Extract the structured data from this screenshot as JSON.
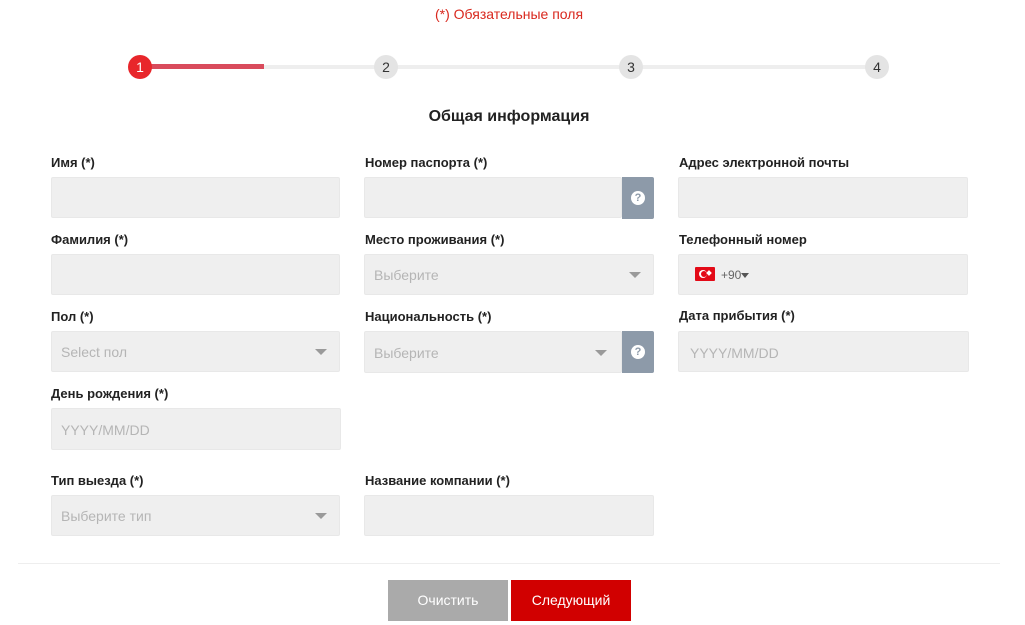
{
  "required_note": "(*) Обязательные поля",
  "stepper": {
    "steps": [
      "1",
      "2",
      "3",
      "4"
    ],
    "active_step": 1,
    "progress": 0.17
  },
  "section_title": "Общая информация",
  "fields": {
    "first_name": {
      "label": "Имя (*)"
    },
    "passport": {
      "label": "Номер паспорта (*)"
    },
    "email": {
      "label": "Адрес электронной почты"
    },
    "last_name": {
      "label": "Фамилия (*)"
    },
    "residence": {
      "label": "Место проживания (*)",
      "placeholder": "Выберите"
    },
    "phone": {
      "label": "Телефонный номер",
      "dial_code": "+90",
      "flag": "turkey-flag"
    },
    "gender": {
      "label": "Пол (*)",
      "placeholder": "Select пол"
    },
    "nationality": {
      "label": "Национальность (*)",
      "placeholder": "Выберите"
    },
    "arrival_date": {
      "label": "Дата прибытия (*)",
      "placeholder": "YYYY/MM/DD"
    },
    "birthday": {
      "label": "День рождения (*)",
      "placeholder": "YYYY/MM/DD"
    },
    "exit_type": {
      "label": "Тип выезда (*)",
      "placeholder": "Выберите тип"
    },
    "company": {
      "label": "Название компании (*)"
    }
  },
  "help_icon": "?",
  "buttons": {
    "clear": "Очистить",
    "next": "Следующий"
  },
  "colors": {
    "accent": "#d10000",
    "required": "#d9281e",
    "help": "#8d9aa9",
    "progress": "#d94b5c"
  }
}
